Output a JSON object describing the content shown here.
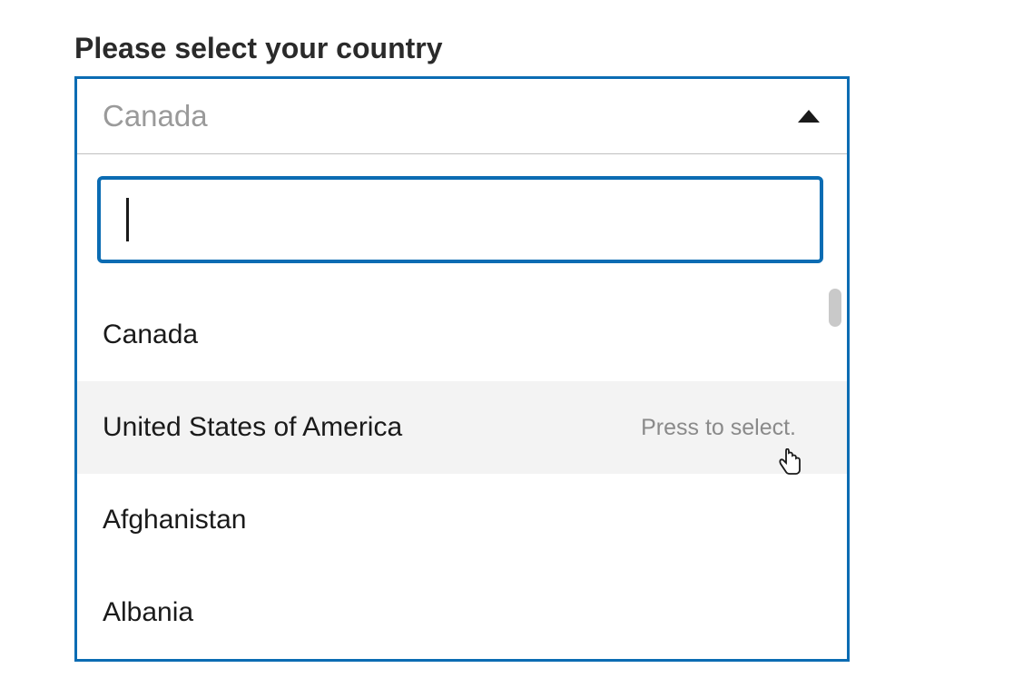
{
  "field": {
    "label": "Please select your country",
    "placeholder": "Canada",
    "search_value": "",
    "hover_hint": "Press to select."
  },
  "options": [
    {
      "label": "Canada",
      "hovered": false
    },
    {
      "label": "United States of America",
      "hovered": true
    },
    {
      "label": "Afghanistan",
      "hovered": false
    },
    {
      "label": "Albania",
      "hovered": false
    }
  ]
}
